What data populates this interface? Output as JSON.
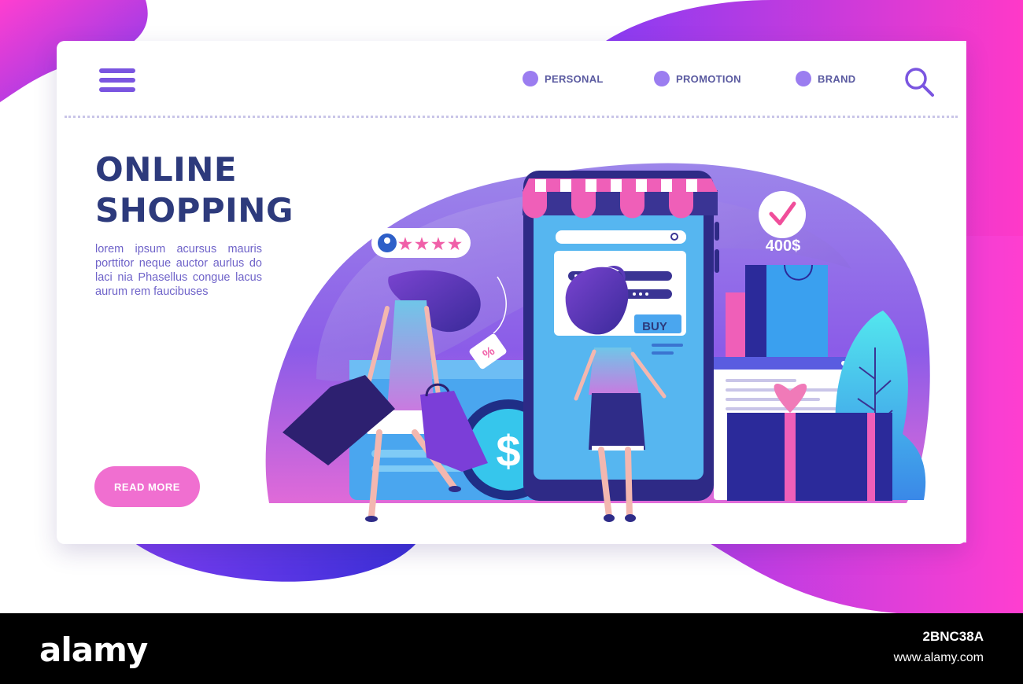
{
  "nav": {
    "items": [
      {
        "label": "PERSONAL"
      },
      {
        "label": "PROMOTION"
      },
      {
        "label": "BRAND"
      }
    ]
  },
  "hero": {
    "title_line1": "ONLINE",
    "title_line2": "SHOPPING",
    "description": "lorem ipsum acursus mauris porttitor neque auctor aurlus do laci nia Phasellus congue lacus aurum rem faucibuses",
    "button_label": "READ MORE"
  },
  "illustration": {
    "buy_label": "BUY",
    "price_label": "400$",
    "coin_symbol": "$",
    "tag_symbol": "%",
    "rating_stars": 4
  },
  "watermark": {
    "brand": "alamy",
    "image_id": "2BNC38A",
    "url": "www.alamy.com"
  },
  "colors": {
    "accent_purple": "#7a55e0",
    "accent_pink": "#f06fd0",
    "title_navy": "#2d3a7c",
    "phone_screen": "#56b6f0"
  }
}
